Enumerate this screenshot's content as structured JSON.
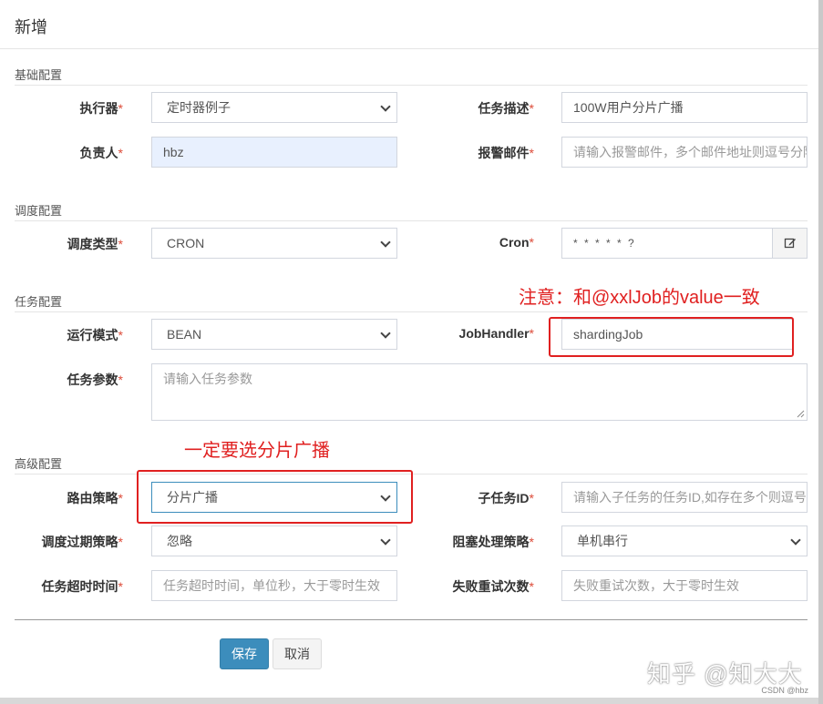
{
  "modal": {
    "title": "新增"
  },
  "sections": {
    "basic": "基础配置",
    "schedule": "调度配置",
    "task": "任务配置",
    "advanced": "高级配置"
  },
  "required_mark": "*",
  "fields": {
    "executor": {
      "label": "执行器",
      "value": "定时器例子"
    },
    "job_desc": {
      "label": "任务描述",
      "value": "100W用户分片广播"
    },
    "author": {
      "label": "负责人",
      "value": "hbz"
    },
    "alarm_email": {
      "label": "报警邮件",
      "placeholder": "请输入报警邮件，多个邮件地址则逗号分隔"
    },
    "schedule_type": {
      "label": "调度类型",
      "value": "CRON"
    },
    "cron": {
      "label": "Cron",
      "value": "* * * * * ?"
    },
    "run_mode": {
      "label": "运行模式",
      "value": "BEAN"
    },
    "job_handler": {
      "label": "JobHandler",
      "value": "shardingJob"
    },
    "job_param": {
      "label": "任务参数",
      "placeholder": "请输入任务参数"
    },
    "route_strategy": {
      "label": "路由策略",
      "value": "分片广播"
    },
    "child_job_id": {
      "label": "子任务ID",
      "placeholder": "请输入子任务的任务ID,如存在多个则逗号分隔"
    },
    "misfire_strategy": {
      "label": "调度过期策略",
      "value": "忽略"
    },
    "block_strategy": {
      "label": "阻塞处理策略",
      "value": "单机串行"
    },
    "timeout": {
      "label": "任务超时时间",
      "placeholder": "任务超时时间，单位秒，大于零时生效"
    },
    "fail_retry": {
      "label": "失败重试次数",
      "placeholder": "失败重试次数，大于零时生效"
    }
  },
  "buttons": {
    "save": "保存",
    "cancel": "取消"
  },
  "annotations": {
    "note_handler": "注意：和@xxlJob的value一致",
    "note_route": "一定要选分片广播"
  },
  "watermark": "知乎 @知大大",
  "csdn_mark": "CSDN @hbz",
  "colors": {
    "primary": "#3c8dbc",
    "annotation": "#e02020",
    "required": "#dd4b39"
  },
  "icons": {
    "edit": "edit-icon",
    "dropdown": "chevron-down-icon"
  }
}
